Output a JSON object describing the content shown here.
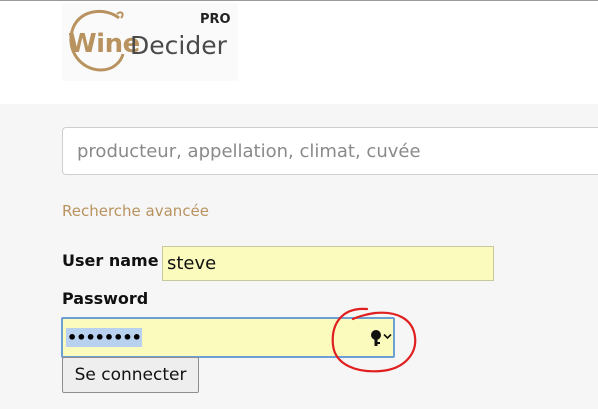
{
  "header": {
    "logo_wine": "Wine",
    "logo_decider": "Decider",
    "logo_pro": "PRO"
  },
  "search": {
    "placeholder": "producteur, appellation, climat, cuvée",
    "value": ""
  },
  "advanced_search_label": "Recherche avancée",
  "login": {
    "username_label": "User name",
    "username_value": "steve",
    "password_label": "Password",
    "password_mask": "••••••••",
    "submit_label": "Se connecter"
  },
  "icons": {
    "password_manager": "key-icon",
    "dropdown": "chevron-down-icon"
  },
  "colors": {
    "brand_gold": "#b9935f",
    "autofill_yellow": "#fafbbd",
    "focus_blue": "#6c9fd4",
    "selection_blue": "#b7d1ee",
    "annotation_red": "#e02020"
  }
}
